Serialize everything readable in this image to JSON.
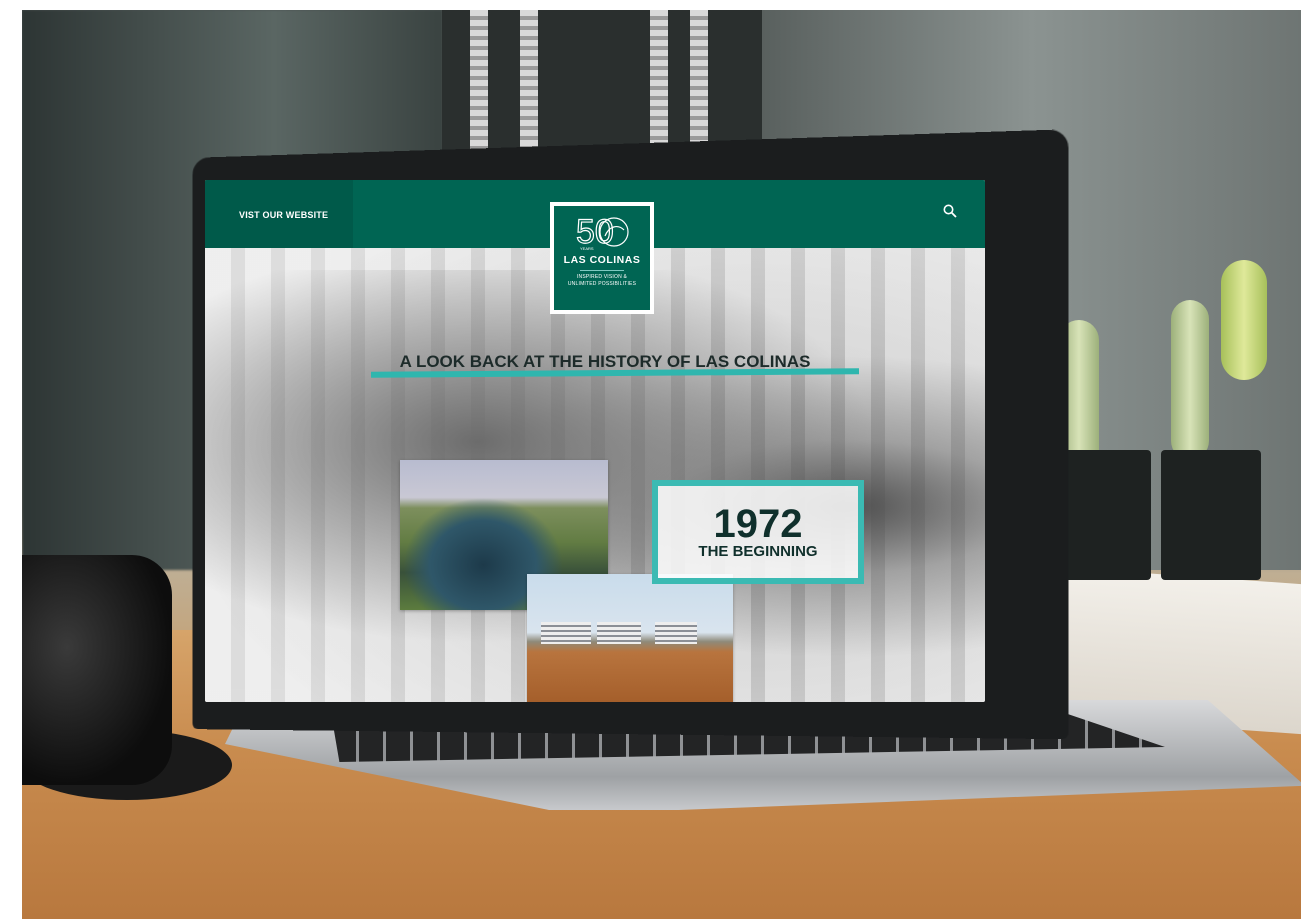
{
  "site": {
    "nav_link": "VIST OUR WEBSITE",
    "logo": {
      "badge": "50",
      "badge_small": "YEARS",
      "name": "LAS COLINAS",
      "tagline_1": "INSPIRED VISION &",
      "tagline_2": "UNLIMITED POSSIBILITIES"
    },
    "headline": "A LOOK BACK AT THE HISTORY OF LAS COLINAS",
    "timeline": {
      "year": "1972",
      "caption": "THE BEGINNING"
    }
  },
  "icons": {
    "search": "search-icon"
  },
  "colors": {
    "brand_green": "#006553",
    "accent_teal": "#3bbab3",
    "dark_text": "#10302c"
  }
}
